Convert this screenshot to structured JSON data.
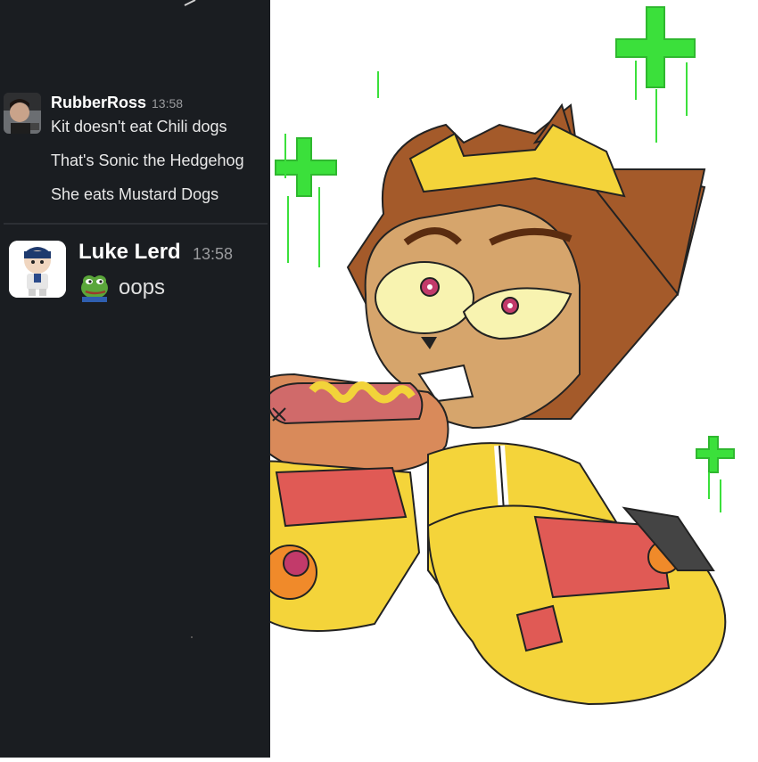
{
  "chat": {
    "messages": [
      {
        "author": "RubberRoss",
        "time": "13:58",
        "lines": [
          "Kit doesn't eat Chili dogs",
          "That's Sonic the Hedgehog",
          "She eats Mustard Dogs"
        ]
      },
      {
        "author": "Luke Lerd",
        "time": "13:58",
        "emoji": "pepe-frog-icon",
        "text": "oops"
      }
    ]
  },
  "artwork": {
    "subject": "cartoon cat character eating a mustard hot dog",
    "colors": {
      "hair": "#a45a2a",
      "skin": "#d6a56c",
      "armor": "#f4d43a",
      "knuckles": "#e05a55",
      "mustard": "#f2d33a",
      "sparkle": "#3be03b"
    }
  },
  "theme": {
    "chat_bg": "#1a1d21",
    "name_color": "#ffffff",
    "text_color": "#e8e8e8",
    "time_color": "#9a9b9e"
  }
}
